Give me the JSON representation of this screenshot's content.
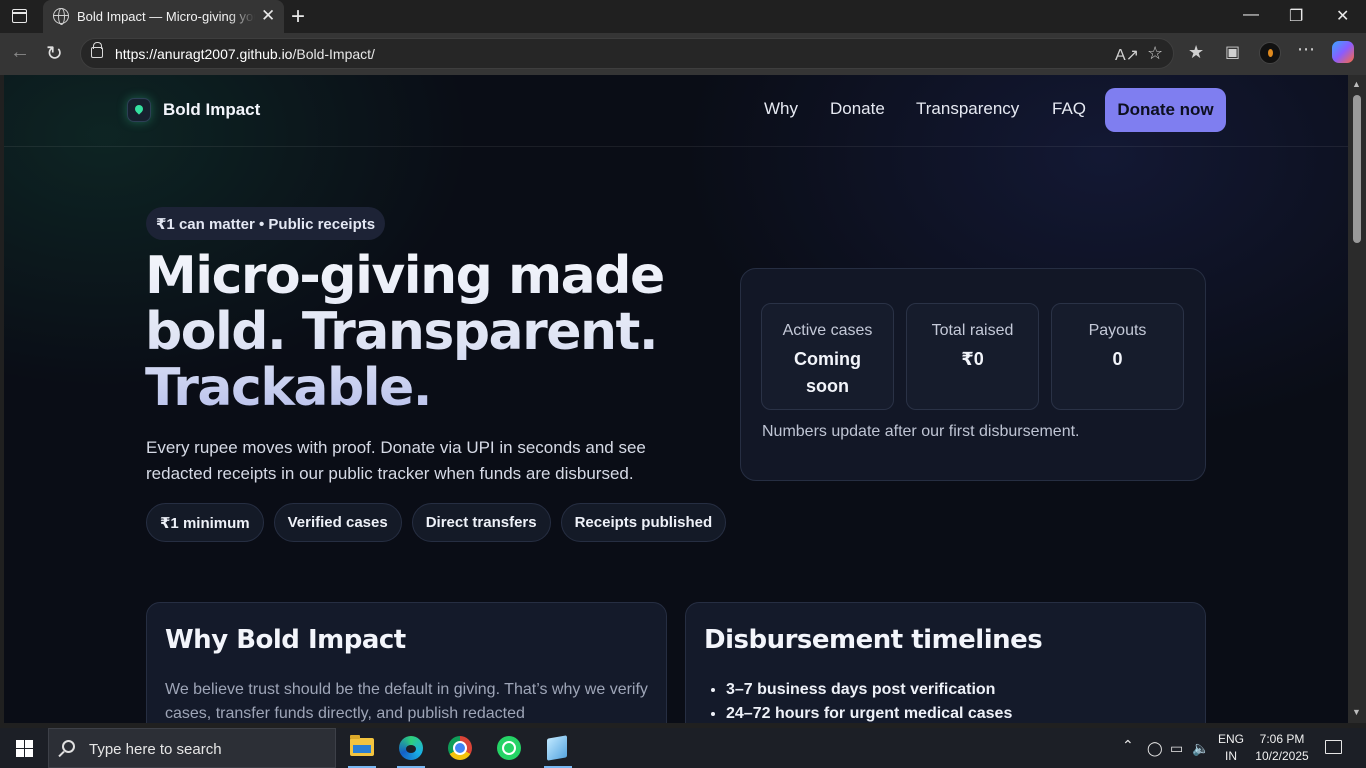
{
  "browser": {
    "tab_title": "Bold Impact — Micro-giving you can track",
    "new_tab": "+",
    "close_tab": "✕",
    "url_host": "https://anuragt2007.github.io",
    "url_path": "/Bold-Impact/",
    "controls": {
      "minimize": "—",
      "maximize": "❐",
      "close": "✕"
    },
    "more": "⋯"
  },
  "site": {
    "brand": "Bold Impact",
    "nav": [
      "Why",
      "Donate",
      "Transparency",
      "FAQ"
    ],
    "cta": "Donate now",
    "hero": {
      "pill": "₹1 can matter • Public receipts",
      "title": "Micro-giving made bold. Transparent. Trackable.",
      "subtitle": "Every rupee moves with proof. Donate via UPI in seconds and see redacted receipts in our public tracker when funds are disbursed.",
      "chips": [
        "₹1 minimum",
        "Verified cases",
        "Direct transfers",
        "Receipts published"
      ]
    },
    "stats": [
      {
        "label": "Active cases",
        "value": "Coming soon"
      },
      {
        "label": "Total raised",
        "value": "₹0"
      },
      {
        "label": "Payouts",
        "value": "0"
      }
    ],
    "stats_note": "Numbers update after our first disbursement.",
    "why": {
      "heading": "Why Bold Impact",
      "text": "We believe trust should be the default in giving. That’s why we verify cases, transfer funds directly, and publish redacted"
    },
    "timelines": {
      "heading": "Disbursement timelines",
      "items": [
        "3–7 business days post verification",
        "24–72 hours for urgent medical cases"
      ]
    }
  },
  "taskbar": {
    "search_placeholder": "Type here to search",
    "lang_top": "ENG",
    "lang_bottom": "IN",
    "time": "7:06 PM",
    "date": "10/2/2025"
  },
  "colors": {
    "accent": "#7f7ef0",
    "page_bg": "#0a0d16",
    "brand_icon": "#35e0a0"
  }
}
